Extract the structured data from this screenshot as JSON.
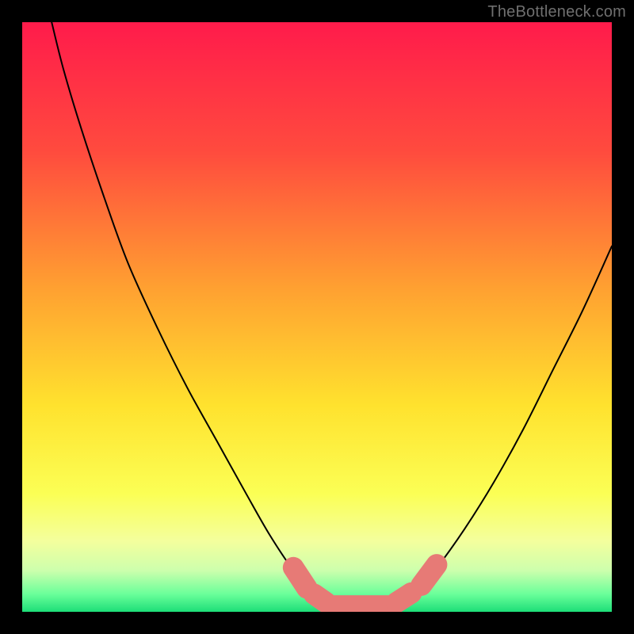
{
  "watermark": "TheBottleneck.com",
  "chart_data": {
    "type": "line",
    "title": "",
    "xlabel": "",
    "ylabel": "",
    "xlim": [
      0,
      100
    ],
    "ylim": [
      0,
      100
    ],
    "gradient_stops": [
      {
        "offset": 0,
        "color": "#ff1b4b"
      },
      {
        "offset": 22,
        "color": "#ff4b3e"
      },
      {
        "offset": 45,
        "color": "#ffa031"
      },
      {
        "offset": 65,
        "color": "#ffe22e"
      },
      {
        "offset": 80,
        "color": "#fbff55"
      },
      {
        "offset": 88,
        "color": "#f4ff9d"
      },
      {
        "offset": 93,
        "color": "#cdffad"
      },
      {
        "offset": 97,
        "color": "#6aff9a"
      },
      {
        "offset": 100,
        "color": "#1dde78"
      }
    ],
    "series": [
      {
        "name": "bottleneck-curve",
        "color": "#000000",
        "stroke_width": 2,
        "points": [
          {
            "x": 5.0,
            "y": 100.0
          },
          {
            "x": 7.0,
            "y": 92.0
          },
          {
            "x": 10.0,
            "y": 82.0
          },
          {
            "x": 14.0,
            "y": 70.0
          },
          {
            "x": 18.0,
            "y": 59.0
          },
          {
            "x": 23.0,
            "y": 48.0
          },
          {
            "x": 28.0,
            "y": 38.0
          },
          {
            "x": 33.0,
            "y": 29.0
          },
          {
            "x": 38.0,
            "y": 20.0
          },
          {
            "x": 42.0,
            "y": 13.0
          },
          {
            "x": 46.0,
            "y": 7.0
          },
          {
            "x": 49.0,
            "y": 3.5
          },
          {
            "x": 52.0,
            "y": 1.5
          },
          {
            "x": 55.0,
            "y": 0.6
          },
          {
            "x": 58.0,
            "y": 0.5
          },
          {
            "x": 61.0,
            "y": 0.6
          },
          {
            "x": 64.0,
            "y": 1.5
          },
          {
            "x": 67.0,
            "y": 3.5
          },
          {
            "x": 70.0,
            "y": 7.0
          },
          {
            "x": 75.0,
            "y": 14.0
          },
          {
            "x": 80.0,
            "y": 22.0
          },
          {
            "x": 85.0,
            "y": 31.0
          },
          {
            "x": 90.0,
            "y": 41.0
          },
          {
            "x": 95.0,
            "y": 51.0
          },
          {
            "x": 100.0,
            "y": 62.0
          }
        ]
      }
    ],
    "markers": {
      "name": "highlight-capsules",
      "color": "#e77a76",
      "items": [
        {
          "x1": 46.0,
          "y1": 7.5,
          "x2": 48.3,
          "y2": 4.0,
          "r": 1.8
        },
        {
          "x1": 49.5,
          "y1": 3.0,
          "x2": 51.5,
          "y2": 1.6,
          "r": 1.8
        },
        {
          "x1": 53.0,
          "y1": 1.0,
          "x2": 62.0,
          "y2": 1.0,
          "r": 1.8
        },
        {
          "x1": 63.5,
          "y1": 1.6,
          "x2": 66.0,
          "y2": 3.2,
          "r": 1.8
        },
        {
          "x1": 67.7,
          "y1": 4.5,
          "x2": 70.3,
          "y2": 8.0,
          "r": 1.8
        }
      ]
    }
  }
}
